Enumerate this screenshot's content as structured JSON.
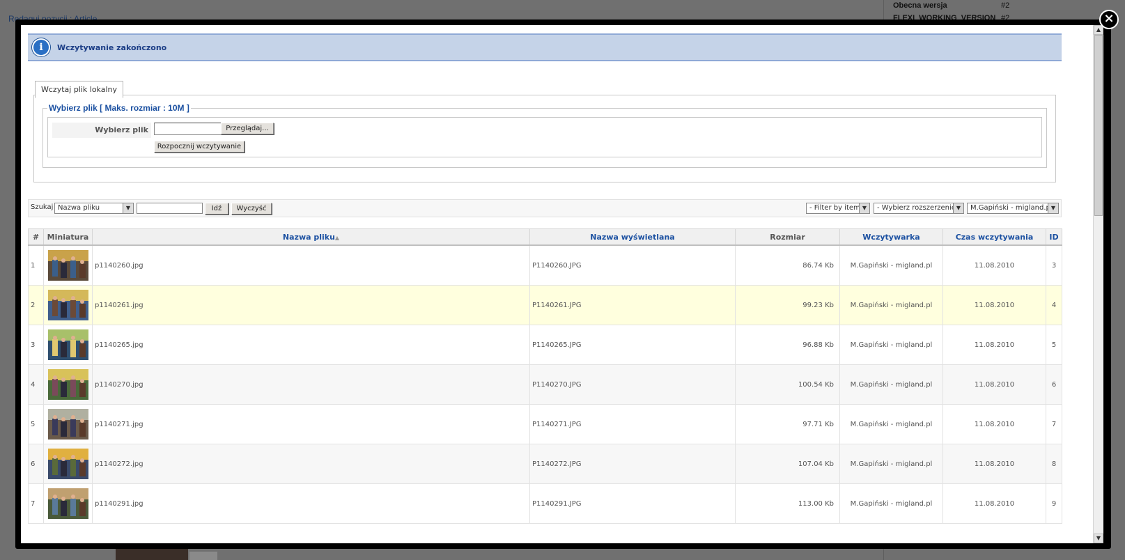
{
  "background": {
    "link": "Redaguj pozycji : Article",
    "rows": [
      {
        "key": "Obecna wersja",
        "value": "#2"
      },
      {
        "key": "FLEXI_WORKING_VERSION",
        "value": "#2"
      }
    ]
  },
  "message": {
    "icon": "info-icon",
    "text": "Wczytywanie zakończono"
  },
  "upload": {
    "tab_label": "Wczytaj plik lokalny",
    "legend": "Wybierz plik [ Maks. rozmiar : 10M ]",
    "file_label": "Wybierz plik",
    "browse_label": "Przeglądaj...",
    "start_label": "Rozpocznij wczytywanie"
  },
  "filters": {
    "search_label": "Szukaj",
    "search_field_select": "Nazwa pliku",
    "search_value": "",
    "go_label": "Idź",
    "clear_label": "Wyczyść",
    "filter_item": "- Filter by item -",
    "filter_ext": "- Wybierz rozszerzenie -",
    "filter_uploader": "M.Gapiński - migland.pl"
  },
  "table": {
    "headers": {
      "num": "#",
      "thumb": "Miniatura",
      "filename": "Nazwa pliku",
      "display": "Nazwa wyświetlana",
      "size": "Rozmiar",
      "uploader": "Wczytywarka",
      "time": "Czas wczytywania",
      "id": "ID"
    },
    "rows": [
      {
        "num": "1",
        "filename": "p1140260.jpg",
        "display": "P1140260.JPG",
        "size": "86.74 Kb",
        "uploader": "M.Gapiński - migland.pl",
        "time": "11.08.2010",
        "id": "3"
      },
      {
        "num": "2",
        "filename": "p1140261.jpg",
        "display": "P1140261.JPG",
        "size": "99.23 Kb",
        "uploader": "M.Gapiński - migland.pl",
        "time": "11.08.2010",
        "id": "4"
      },
      {
        "num": "3",
        "filename": "p1140265.jpg",
        "display": "P1140265.JPG",
        "size": "96.88 Kb",
        "uploader": "M.Gapiński - migland.pl",
        "time": "11.08.2010",
        "id": "5"
      },
      {
        "num": "4",
        "filename": "p1140270.jpg",
        "display": "P1140270.JPG",
        "size": "100.54 Kb",
        "uploader": "M.Gapiński - migland.pl",
        "time": "11.08.2010",
        "id": "6"
      },
      {
        "num": "5",
        "filename": "p1140271.jpg",
        "display": "P1140271.JPG",
        "size": "97.71 Kb",
        "uploader": "M.Gapiński - migland.pl",
        "time": "11.08.2010",
        "id": "7"
      },
      {
        "num": "6",
        "filename": "p1140272.jpg",
        "display": "P1140272.JPG",
        "size": "107.04 Kb",
        "uploader": "M.Gapiński - migland.pl",
        "time": "11.08.2010",
        "id": "8"
      },
      {
        "num": "7",
        "filename": "p1140291.jpg",
        "display": "P1140291.JPG",
        "size": "113.00 Kb",
        "uploader": "M.Gapiński - migland.pl",
        "time": "11.08.2010",
        "id": "9"
      }
    ]
  },
  "close_icon": "close-icon",
  "colors": {
    "accent": "#1b50a1",
    "message_bg": "#c5d3e8",
    "highlight_row": "#ffffde"
  }
}
